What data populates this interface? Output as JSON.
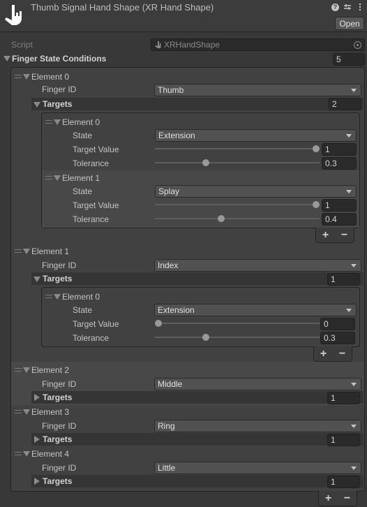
{
  "header": {
    "title": "Thumb Signal Hand Shape (XR Hand Shape)",
    "icons": [
      "hand-sign-icon",
      "help-icon",
      "preset-settings-icon",
      "more-options-icon"
    ],
    "open_label": "Open"
  },
  "script": {
    "label": "Script",
    "value": "XRHandShape"
  },
  "conditions": {
    "label": "Finger State Conditions",
    "size": "5",
    "elements": [
      {
        "label": "Element 0",
        "finger_id_label": "Finger ID",
        "finger_id": "Thumb",
        "targets_label": "Targets",
        "targets_size": "2",
        "expanded": true,
        "targets": [
          {
            "label": "Element 0",
            "state_label": "State",
            "state": "Extension",
            "target_value_label": "Target Value",
            "target_value": "1",
            "target_value_fraction": 1.0,
            "tolerance_label": "Tolerance",
            "tolerance": "0.3",
            "tolerance_fraction": 0.3
          },
          {
            "label": "Element 1",
            "state_label": "State",
            "state": "Splay",
            "target_value_label": "Target Value",
            "target_value": "1",
            "target_value_fraction": 1.0,
            "tolerance_label": "Tolerance",
            "tolerance": "0.4",
            "tolerance_fraction": 0.4
          }
        ]
      },
      {
        "label": "Element 1",
        "finger_id_label": "Finger ID",
        "finger_id": "Index",
        "targets_label": "Targets",
        "targets_size": "1",
        "expanded": true,
        "targets": [
          {
            "label": "Element 0",
            "state_label": "State",
            "state": "Extension",
            "target_value_label": "Target Value",
            "target_value": "0",
            "target_value_fraction": 0.0,
            "tolerance_label": "Tolerance",
            "tolerance": "0.3",
            "tolerance_fraction": 0.3
          }
        ]
      },
      {
        "label": "Element 2",
        "finger_id_label": "Finger ID",
        "finger_id": "Middle",
        "targets_label": "Targets",
        "targets_size": "1",
        "expanded": false
      },
      {
        "label": "Element 3",
        "finger_id_label": "Finger ID",
        "finger_id": "Ring",
        "targets_label": "Targets",
        "targets_size": "1",
        "expanded": false
      },
      {
        "label": "Element 4",
        "finger_id_label": "Finger ID",
        "finger_id": "Little",
        "targets_label": "Targets",
        "targets_size": "1",
        "expanded": false
      }
    ]
  },
  "list_buttons": {
    "add": "+",
    "remove": "−"
  }
}
